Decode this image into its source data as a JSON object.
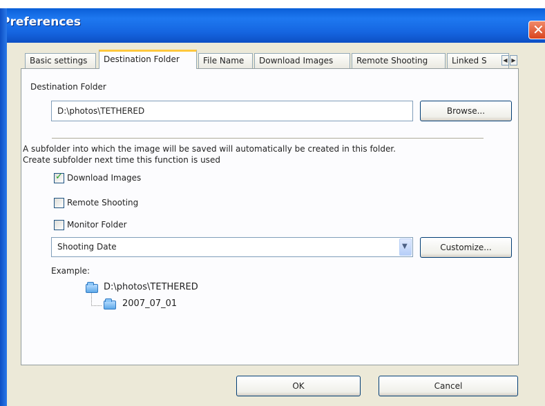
{
  "window": {
    "title": "Preferences",
    "close_glyph": "✕"
  },
  "tabs": [
    {
      "label": "Basic settings"
    },
    {
      "label": "Destination Folder",
      "active": true
    },
    {
      "label": "File Name"
    },
    {
      "label": "Download Images"
    },
    {
      "label": "Remote Shooting"
    },
    {
      "label": "Linked S"
    }
  ],
  "tab_scroll": {
    "left": "◀",
    "right": "▶"
  },
  "destination": {
    "section_label": "Destination Folder",
    "path_value": "D:\\photos\\TETHERED",
    "browse_label": "Browse..."
  },
  "subfolder": {
    "description_line1": "A subfolder into which the image will be saved will automatically be created in this folder.",
    "description_line2": "Create subfolder next time this function is used",
    "options": [
      {
        "label": "Download Images",
        "checked": true
      },
      {
        "label": "Remote Shooting",
        "checked": false
      },
      {
        "label": "Monitor Folder",
        "checked": false
      }
    ],
    "naming_selected": "Shooting Date",
    "customize_label": "Customize..."
  },
  "example": {
    "label": "Example:",
    "root": "D:\\photos\\TETHERED",
    "child": "2007_07_01"
  },
  "footer": {
    "ok_label": "OK",
    "cancel_label": "Cancel"
  },
  "colors": {
    "titlebar": "#1565e0",
    "client": "#ece9d8",
    "active_tab_accent": "#ffc83c",
    "check": "#21a121"
  },
  "icons": [
    "close-icon",
    "folder-icon",
    "chevron-down-icon",
    "arrow-left-icon",
    "arrow-right-icon",
    "check-icon"
  ]
}
